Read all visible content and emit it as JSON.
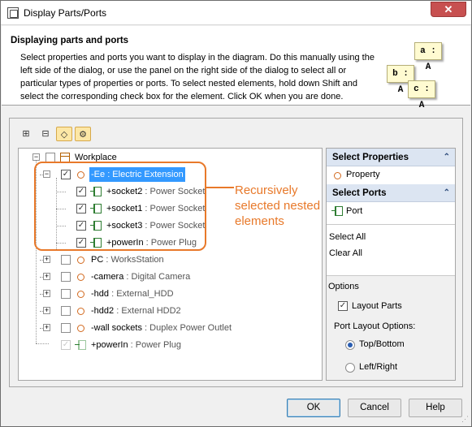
{
  "window": {
    "title": "Display Parts/Ports",
    "close_glyph": "✕"
  },
  "header": {
    "title": "Displaying parts and ports",
    "description": "Select properties and ports you want to display in the diagram. Do this manually using the left side of the dialog, or use the panel on the right side of the dialog to select all or particular types of properties or ports. To select nested elements, hold down Shift and select the corresponding check box for the element. Click OK when you are done.",
    "badges": [
      "a : A",
      "b : A",
      "c : A"
    ]
  },
  "toolbar": {
    "buttons": [
      {
        "name": "expand-all-icon",
        "glyph": "⊞"
      },
      {
        "name": "collapse-all-icon",
        "glyph": "⊟"
      },
      {
        "name": "show-ports-icon",
        "glyph": "◇"
      },
      {
        "name": "show-properties-icon",
        "glyph": "⚙"
      }
    ]
  },
  "tree": {
    "root": {
      "label": "Workplace"
    },
    "ee": {
      "name": "-Ee",
      "type": ": Electric Extension"
    },
    "socket2": {
      "name": "+socket2",
      "type": ": Power Socket"
    },
    "socket1": {
      "name": "+socket1",
      "type": ": Power Socket"
    },
    "socket3": {
      "name": "+socket3",
      "type": ": Power Socket"
    },
    "powerIn_nested": {
      "name": "+powerIn",
      "type": ": Power Plug"
    },
    "pc": {
      "name": "PC",
      "type": ": WorksStation"
    },
    "camera": {
      "name": "-camera",
      "type": ": Digital Camera"
    },
    "hdd": {
      "name": "-hdd",
      "type": ": External_HDD"
    },
    "hdd2": {
      "name": "-hdd2",
      "type": ": External HDD2"
    },
    "wall": {
      "name": "-wall sockets",
      "type": ": Duplex Power Outlet"
    },
    "powerIn_root": {
      "name": "+powerIn",
      "type": ": Power Plug"
    }
  },
  "annotation": {
    "text_line1": "Recursively",
    "text_line2": "selected nested",
    "text_line3": "elements"
  },
  "right_panel": {
    "select_properties": {
      "title": "Select Properties",
      "item": "Property",
      "chevron": "⌃"
    },
    "select_ports": {
      "title": "Select Ports",
      "item": "Port",
      "chevron": "⌃"
    },
    "select_all": "Select All",
    "clear_all": "Clear All",
    "options": {
      "title": "Options",
      "layout_parts": "Layout Parts",
      "port_layout_title": "Port Layout Options:",
      "top_bottom": "Top/Bottom",
      "left_right": "Left/Right"
    }
  },
  "buttons": {
    "ok": "OK",
    "cancel": "Cancel",
    "help": "Help"
  },
  "check_glyph": "✓",
  "colors": {
    "accent_orange": "#e8792a",
    "selection_blue": "#3399ff",
    "section_header": "#dce5f2"
  }
}
